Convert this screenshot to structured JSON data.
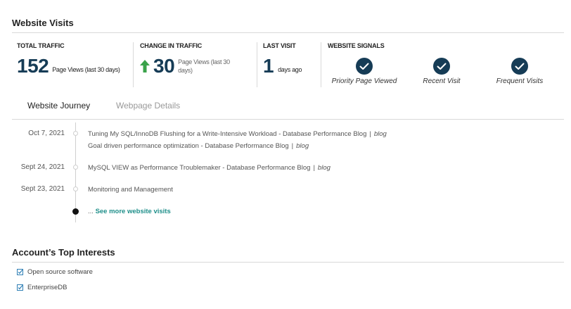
{
  "website_visits": {
    "title": "Website Visits",
    "total_traffic": {
      "label": "TOTAL TRAFFIC",
      "value": "152",
      "note": "Page Views (last 30 days)"
    },
    "change_in_traffic": {
      "label": "CHANGE IN TRAFFIC",
      "value": "30",
      "note": "Page Views (last 30 days)",
      "direction": "up",
      "arrow_color": "#3aa24a"
    },
    "last_visit": {
      "label": "LAST VISIT",
      "value": "1",
      "note": "days ago"
    },
    "signals": {
      "label": "WEBSITE SIGNALS",
      "items": [
        {
          "label": "Priority Page Viewed",
          "icon": "check-icon"
        },
        {
          "label": "Recent Visit",
          "icon": "check-icon"
        },
        {
          "label": "Frequent Visits",
          "icon": "check-icon"
        }
      ]
    },
    "accent_color": "#163c56"
  },
  "tabs": [
    {
      "label": "Website Journey",
      "active": true
    },
    {
      "label": "Webpage Details",
      "active": false
    }
  ],
  "journey": {
    "entries": [
      {
        "date": "Oct 7, 2021",
        "lines": [
          {
            "page": "Tuning My SQL/InnoDB Flushing for a Write-Intensive Workload - Database Performance Blog",
            "sep": "|",
            "tag": "blog"
          },
          {
            "page": "Goal driven performance optimization - Database Performance Blog",
            "sep": "|",
            "tag": "blog"
          }
        ]
      },
      {
        "date": "Sept 24, 2021",
        "lines": [
          {
            "page": "MySQL VIEW as Performance Troublemaker - Database Performance Blog",
            "sep": "|",
            "tag": "blog"
          }
        ]
      },
      {
        "date": "Sept 23, 2021",
        "lines": [
          {
            "page": "Monitoring and Management",
            "sep": "",
            "tag": ""
          }
        ]
      }
    ],
    "see_more_prefix": "...",
    "see_more_label": "See more website visits"
  },
  "top_interests": {
    "title": "Account’s Top Interests",
    "items": [
      "Open source software",
      "EnterpriseDB"
    ]
  }
}
